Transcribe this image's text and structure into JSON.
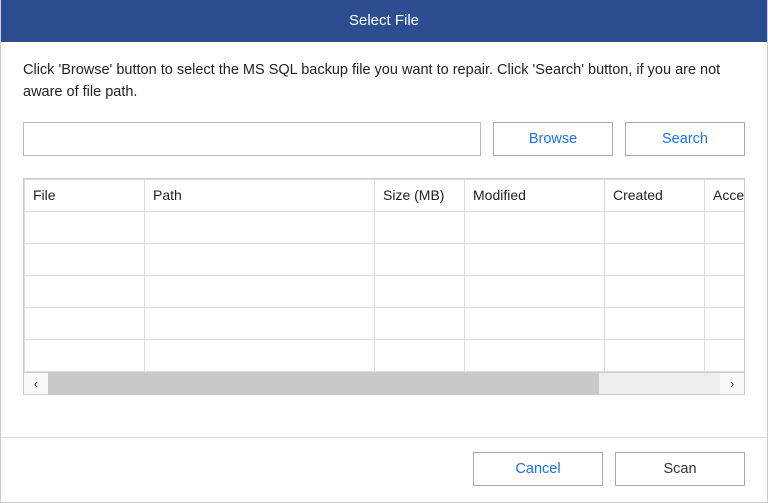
{
  "title": "Select File",
  "instructions": "Click 'Browse' button to select the MS SQL backup file you want to repair.  Click 'Search' button, if you are not aware of file path.",
  "path_input": {
    "value": "",
    "placeholder": ""
  },
  "buttons": {
    "browse": "Browse",
    "search": "Search",
    "cancel": "Cancel",
    "scan": "Scan"
  },
  "table": {
    "columns": [
      "File",
      "Path",
      "Size (MB)",
      "Modified",
      "Created",
      "Acce"
    ],
    "rows": [
      [
        "",
        "",
        "",
        "",
        "",
        ""
      ],
      [
        "",
        "",
        "",
        "",
        "",
        ""
      ],
      [
        "",
        "",
        "",
        "",
        "",
        ""
      ],
      [
        "",
        "",
        "",
        "",
        "",
        ""
      ],
      [
        "",
        "",
        "",
        "",
        "",
        ""
      ]
    ]
  },
  "scroll": {
    "left_glyph": "‹",
    "right_glyph": "›"
  }
}
